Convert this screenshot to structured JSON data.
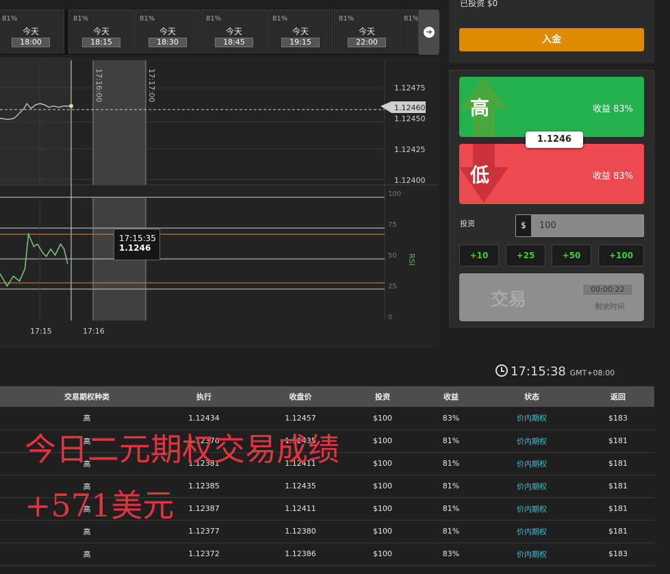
{
  "expiry": {
    "cards": [
      {
        "pct": "81%",
        "day": "今天",
        "time": "18:00"
      },
      {
        "pct": "81%",
        "day": "今天",
        "time": "18:15"
      },
      {
        "pct": "81%",
        "day": "今天",
        "time": "18:30"
      },
      {
        "pct": "81%",
        "day": "今天",
        "time": "18:45"
      },
      {
        "pct": "81%",
        "day": "今天",
        "time": "19:15"
      },
      {
        "pct": "81%",
        "day": "今天",
        "time": "22:00"
      },
      {
        "pct": "81%",
        "day": "",
        "time": ""
      }
    ]
  },
  "chart": {
    "price_ticks": [
      "1.12475",
      "1.12450",
      "1.12425",
      "1.12400"
    ],
    "current_price_tag": "1.12460",
    "rsi_ticks": [
      "100",
      "75",
      "50",
      "25",
      "0"
    ],
    "rsi_label": "RSI",
    "time_ticks": [
      "17:15",
      "17:16"
    ],
    "vertical_labels": [
      "17:16:00",
      "17:17:00"
    ],
    "tooltip": {
      "time": "17:15:35",
      "price": "1.1246"
    },
    "price_series": [
      [
        0.0,
        1.1245
      ],
      [
        0.09,
        1.12449
      ],
      [
        0.16,
        1.1245
      ],
      [
        0.23,
        1.12455
      ],
      [
        0.27,
        1.12458
      ],
      [
        0.3,
        1.12462
      ],
      [
        0.35,
        1.12458
      ],
      [
        0.4,
        1.12461
      ],
      [
        0.45,
        1.12462
      ],
      [
        0.5,
        1.12461
      ],
      [
        0.55,
        1.12459
      ],
      [
        0.6,
        1.1246
      ],
      [
        0.66,
        1.12459
      ],
      [
        0.72,
        1.1246
      ],
      [
        0.8,
        1.1246
      ]
    ],
    "rsi_series": [
      [
        0.0,
        38
      ],
      [
        0.08,
        28
      ],
      [
        0.15,
        36
      ],
      [
        0.22,
        32
      ],
      [
        0.28,
        42
      ],
      [
        0.32,
        70
      ],
      [
        0.38,
        60
      ],
      [
        0.42,
        62
      ],
      [
        0.48,
        55
      ],
      [
        0.52,
        52
      ],
      [
        0.57,
        58
      ],
      [
        0.62,
        53
      ],
      [
        0.68,
        62
      ],
      [
        0.72,
        58
      ],
      [
        0.76,
        46
      ]
    ]
  },
  "account": {
    "invested_label": "已投资 $0",
    "deposit_label": "入金"
  },
  "trade": {
    "high_label": "高",
    "high_payout": "收益 83%",
    "low_label": "低",
    "low_payout": "收益 83%",
    "current_price": "1.1246",
    "invest_label": "投资",
    "currency": "$",
    "amount": "100",
    "quick": [
      "+10",
      "+25",
      "+50",
      "+100"
    ],
    "trade_label": "交易",
    "timer": "00:00:22",
    "remaining_label": "剩余时间"
  },
  "clock": {
    "time": "17:15:38",
    "tz": "GMT+08:00"
  },
  "history": {
    "headers": [
      "",
      "交易期权种类",
      "执行",
      "收盘价",
      "投资",
      "收益",
      "状态",
      "返回"
    ],
    "rows": [
      [
        "",
        "高",
        "1.12434",
        "1.12457",
        "$100",
        "83%",
        "价内期权",
        "$183"
      ],
      [
        "",
        "高",
        "1.12376",
        "1.12435",
        "$100",
        "81%",
        "价内期权",
        "$181"
      ],
      [
        "",
        "高",
        "1.12381",
        "1.12411",
        "$100",
        "81%",
        "价内期权",
        "$181"
      ],
      [
        "",
        "高",
        "1.12385",
        "1.12435",
        "$100",
        "81%",
        "价内期权",
        "$181"
      ],
      [
        "",
        "高",
        "1.12387",
        "1.12411",
        "$100",
        "81%",
        "价内期权",
        "$181"
      ],
      [
        "",
        "高",
        "1.12377",
        "1.12380",
        "$100",
        "81%",
        "价内期权",
        "$181"
      ],
      [
        "",
        "高",
        "1.12372",
        "1.12386",
        "$100",
        "83%",
        "价内期权",
        "$183"
      ]
    ]
  },
  "overlay": {
    "line1": "今日二元期权交易成绩",
    "line2": "+571美元"
  },
  "colors": {
    "high": "#22b14c",
    "low": "#ee4a50",
    "deposit": "#e08a00",
    "status": "#39c1d6",
    "overlay": "#e0343f"
  }
}
